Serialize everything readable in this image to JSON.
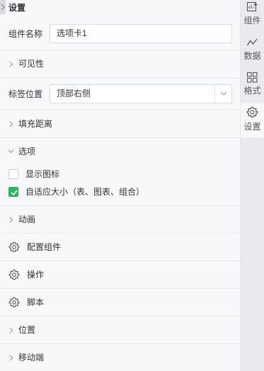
{
  "panel": {
    "title": "设置",
    "component_name_label": "组件名称",
    "component_name_value": "选项卡1",
    "tab_position_label": "标签位置",
    "tab_position_value": "顶部右侧"
  },
  "sections": {
    "visibility": "可见性",
    "padding": "填充距离",
    "options": "选项",
    "animation": "动画",
    "configure_component": "配置组件",
    "actions": "操作",
    "script": "脚本",
    "position": "位置",
    "mobile": "移动端"
  },
  "options": [
    {
      "label": "显示图标",
      "checked": false
    },
    {
      "label": "自适应大小（表、图表、组合）",
      "checked": true
    }
  ],
  "rail": [
    {
      "label": "组件",
      "icon": "add-component-icon",
      "active": false
    },
    {
      "label": "数据",
      "icon": "line-chart-icon",
      "active": false
    },
    {
      "label": "格式",
      "icon": "grid-format-icon",
      "active": false
    },
    {
      "label": "设置",
      "icon": "gear-icon",
      "active": true
    }
  ],
  "colors": {
    "checked": "#2db55d",
    "panel_bg": "#f7f8fa",
    "rail_bg": "#e9ebee"
  }
}
